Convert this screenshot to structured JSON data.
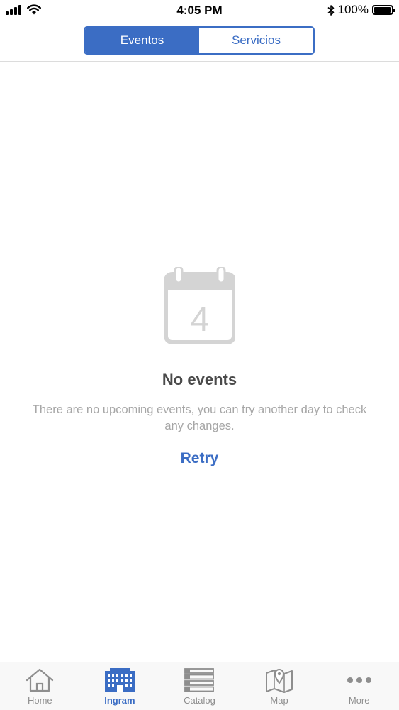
{
  "status_bar": {
    "time": "4:05 PM",
    "battery": "100%",
    "battery_level": 1.0
  },
  "segmented_control": {
    "tabs": [
      {
        "label": "Eventos",
        "active": true
      },
      {
        "label": "Servicios",
        "active": false
      }
    ]
  },
  "empty_state": {
    "icon": "calendar-icon",
    "calendar_day": "4",
    "title": "No events",
    "message": "There are no upcoming events, you can try another day to check any changes.",
    "retry_label": "Retry"
  },
  "tab_bar": {
    "items": [
      {
        "label": "Home",
        "icon": "home-icon",
        "active": false
      },
      {
        "label": "Ingram",
        "icon": "building-icon",
        "active": true
      },
      {
        "label": "Catalog",
        "icon": "list-icon",
        "active": false
      },
      {
        "label": "Map",
        "icon": "map-icon",
        "active": false
      },
      {
        "label": "More",
        "icon": "more-icon",
        "active": false
      }
    ]
  },
  "colors": {
    "accent": "#3b6dc4",
    "muted_text": "#a6a6a6",
    "icon_gray": "#d4d4d4",
    "tab_inactive": "#8e8e8e"
  }
}
